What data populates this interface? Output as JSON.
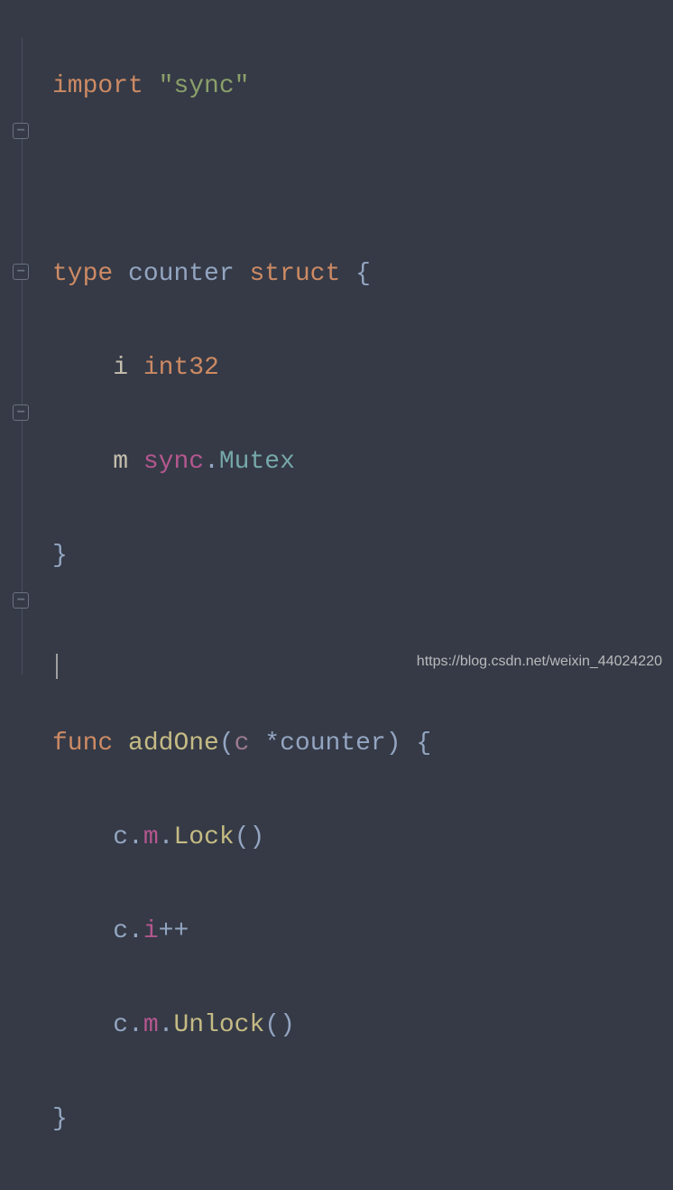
{
  "code": {
    "l1": {
      "kw": "import",
      "str": "\"sync\""
    },
    "l3": {
      "kw1": "type",
      "name": "counter",
      "kw2": "struct",
      "brace": " {"
    },
    "l4": {
      "field": "i",
      "type": "int32"
    },
    "l5": {
      "field": "m",
      "pkg": "sync",
      "dot": ".",
      "type": "Mutex"
    },
    "l6": {
      "brace": "}"
    },
    "l8": {
      "kw": "func",
      "name": "addOne",
      "lp": "(",
      "param": "c",
      "star": " *",
      "ptype": "counter",
      "rp": ")",
      "brace": " {"
    },
    "l9": {
      "recv": "c",
      "d1": ".",
      "f": "m",
      "d2": ".",
      "method": "Lock",
      "paren": "()"
    },
    "l10": {
      "recv": "c",
      "d1": ".",
      "f": "i",
      "op": "++"
    },
    "l11": {
      "recv": "c",
      "d1": ".",
      "f": "m",
      "d2": ".",
      "method": "Unlock",
      "paren": "()"
    },
    "l12": {
      "brace": "}"
    }
  },
  "watermark": "https://blog.csdn.net/weixin_44024220"
}
